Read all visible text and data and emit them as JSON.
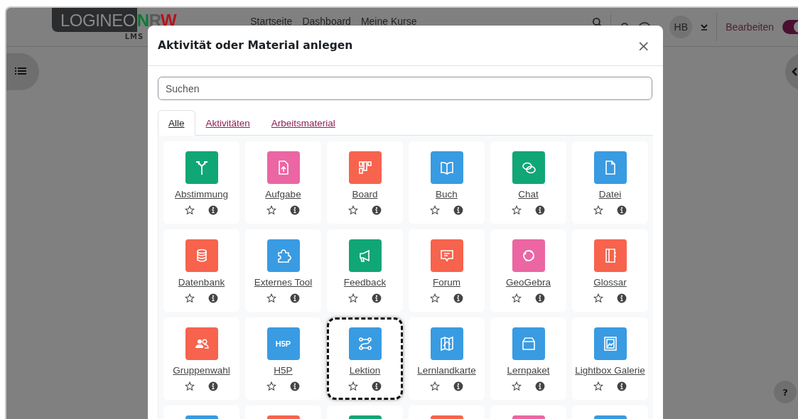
{
  "header": {
    "logo": {
      "text": "LOGINEO",
      "accent": "NRW",
      "sub": "LMS"
    },
    "nav": [
      "Startseite",
      "Dashboard",
      "Meine Kurse"
    ],
    "avatar": "HB",
    "edit_toggle": {
      "label": "Bearbeiten",
      "on": true
    }
  },
  "help_button": "?",
  "modal": {
    "title": "Aktivität oder Material anlegen",
    "close": "×",
    "search": {
      "placeholder": "Suchen"
    },
    "tabs": [
      {
        "label": "Alle",
        "selected": true
      },
      {
        "label": "Aktivitäten",
        "selected": false
      },
      {
        "label": "Arbeitsmaterial",
        "selected": false
      }
    ],
    "items": [
      {
        "label": "Abstimmung",
        "color": "#11a676",
        "starred": false,
        "highlighted": false
      },
      {
        "label": "Aufgabe",
        "color": "#eb66a2",
        "starred": false,
        "highlighted": false
      },
      {
        "label": "Board",
        "color": "#f7634d",
        "starred": false,
        "highlighted": false
      },
      {
        "label": "Buch",
        "color": "#399be2",
        "starred": false,
        "highlighted": false
      },
      {
        "label": "Chat",
        "color": "#11a676",
        "starred": false,
        "highlighted": false
      },
      {
        "label": "Datei",
        "color": "#399be2",
        "starred": false,
        "highlighted": false
      },
      {
        "label": "Datenbank",
        "color": "#f7634d",
        "starred": false,
        "highlighted": false
      },
      {
        "label": "Externes Tool",
        "color": "#399be2",
        "starred": false,
        "highlighted": false
      },
      {
        "label": "Feedback",
        "color": "#11a676",
        "starred": false,
        "highlighted": false
      },
      {
        "label": "Forum",
        "color": "#f7634d",
        "starred": false,
        "highlighted": false
      },
      {
        "label": "GeoGebra",
        "color": "#eb66a2",
        "starred": false,
        "highlighted": false
      },
      {
        "label": "Glossar",
        "color": "#f7634d",
        "starred": false,
        "highlighted": false
      },
      {
        "label": "Gruppenwahl",
        "color": "#f7634d",
        "starred": false,
        "highlighted": false
      },
      {
        "label": "H5P",
        "color": "#399be2",
        "starred": false,
        "highlighted": false,
        "icon_text": "H5P"
      },
      {
        "label": "Lektion",
        "color": "#399be2",
        "starred": false,
        "highlighted": true
      },
      {
        "label": "Lernlandkarte",
        "color": "#399be2",
        "starred": false,
        "highlighted": false
      },
      {
        "label": "Lernpaket",
        "color": "#399be2",
        "starred": false,
        "highlighted": false
      },
      {
        "label": "Lightbox Galerie",
        "color": "#399be2",
        "starred": false,
        "highlighted": false
      },
      {
        "color": "#399be2"
      },
      {
        "color": "#f7634d"
      },
      {
        "color": "#11a676"
      },
      {
        "color": "#f7634d"
      },
      {
        "color": "#eb66a2"
      },
      {
        "color": "#399be2"
      }
    ]
  }
}
